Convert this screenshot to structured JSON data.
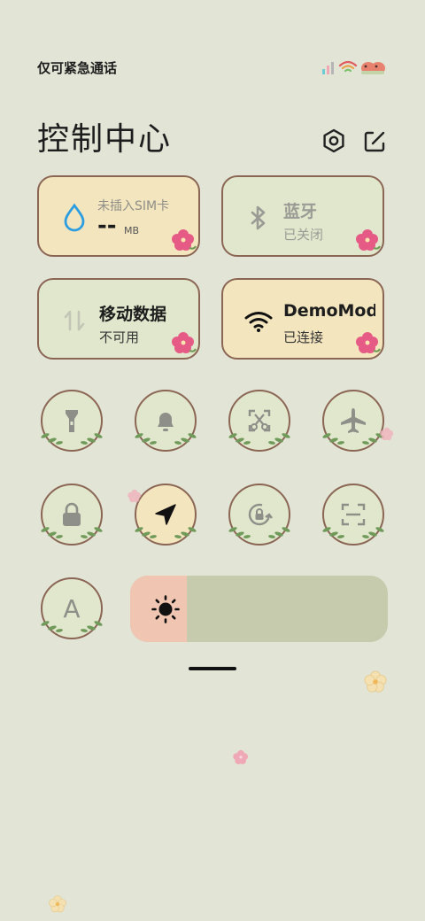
{
  "status_bar": {
    "carrier_text": "仅可紧急通话"
  },
  "header": {
    "title": "控制中心"
  },
  "tiles": {
    "data_usage": {
      "label": "未插入SIM卡",
      "value": "--",
      "unit": "MB"
    },
    "bluetooth": {
      "title": "蓝牙",
      "status": "已关闭"
    },
    "mobile_data": {
      "title": "移动数据",
      "status": "不可用"
    },
    "wifi": {
      "title": "DemoMod",
      "status": "已连接"
    }
  },
  "toggles": [
    {
      "icon": "flashlight-icon",
      "active": false
    },
    {
      "icon": "bell-icon",
      "active": false
    },
    {
      "icon": "screenshot-icon",
      "active": false
    },
    {
      "icon": "airplane-icon",
      "active": false
    },
    {
      "icon": "lock-icon",
      "active": false
    },
    {
      "icon": "location-icon",
      "active": true
    },
    {
      "icon": "rotation-lock-icon",
      "active": false
    },
    {
      "icon": "scan-icon",
      "active": false
    }
  ],
  "auto_brightness": {
    "icon": "auto-brightness-icon",
    "letter": "A"
  },
  "brightness": {
    "level": 0.22,
    "icon": "sun-icon"
  },
  "colors": {
    "background": "#e2e4d6",
    "tile_cream": "#f3e5be",
    "tile_green": "#e1e7cc",
    "tile_border": "#8b6655",
    "brightness_fill": "#f0c5b1",
    "brightness_track": "#c7cbad",
    "water_drop": "#2c9de0"
  }
}
